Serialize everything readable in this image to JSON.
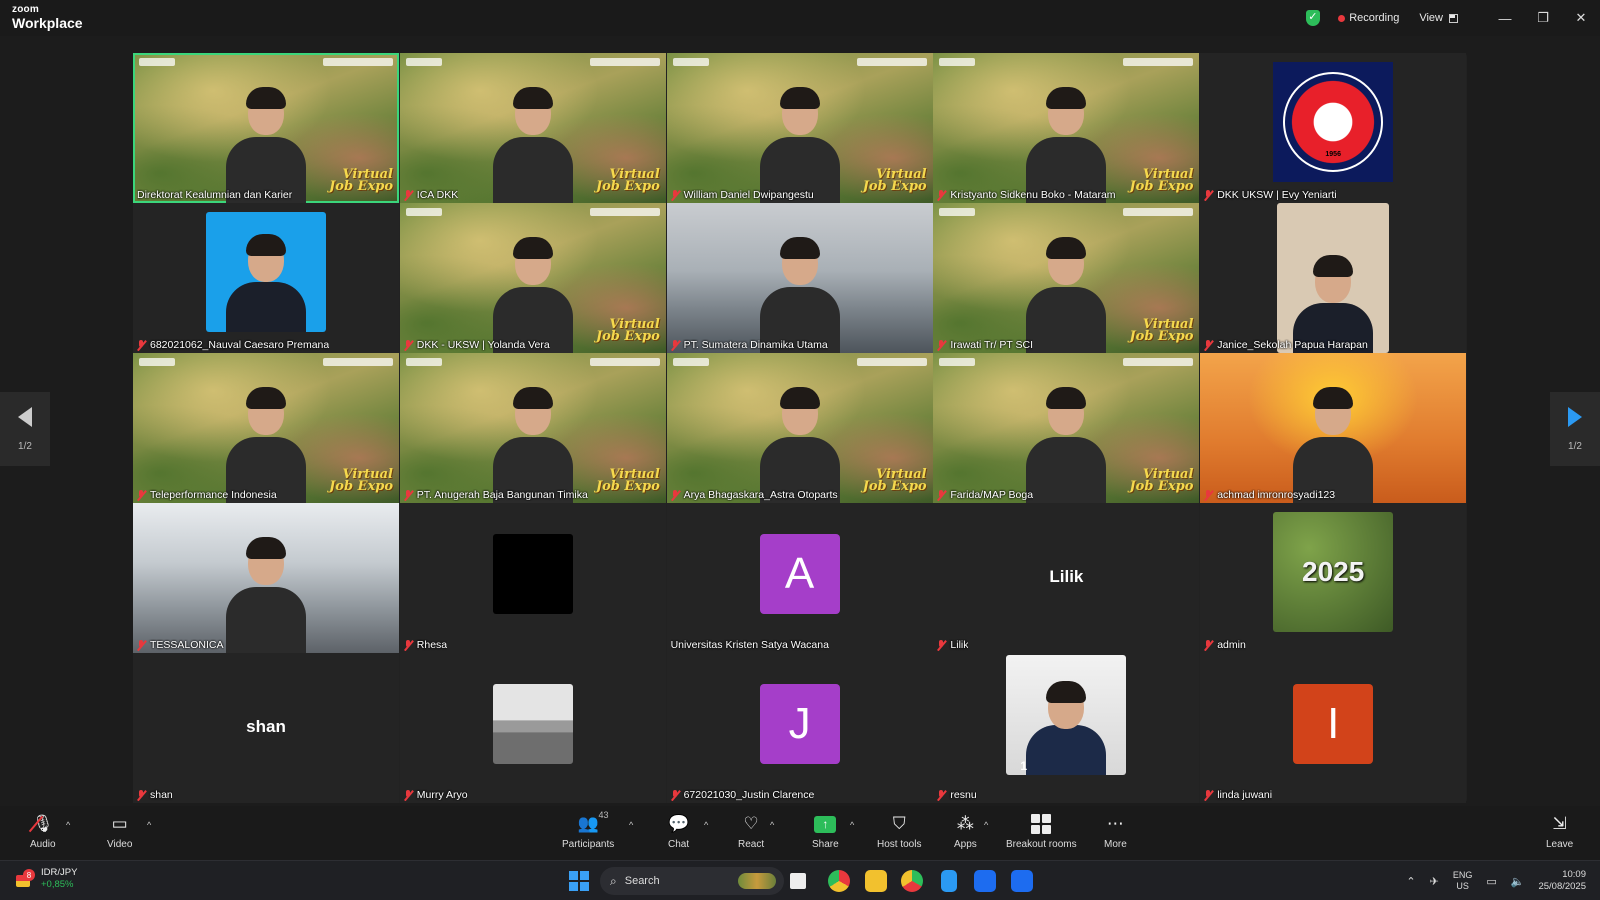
{
  "app": {
    "logo_top": "zoom",
    "logo_bottom": "Workplace",
    "recording_label": "Recording",
    "view_label": "View"
  },
  "window_controls": {
    "minimize": "—",
    "restore": "❐",
    "close": "✕"
  },
  "tiles": [
    {
      "name": "Direktorat Kealumnian dan Karier",
      "type": "video",
      "bg": "expo",
      "muted": false,
      "active": true
    },
    {
      "name": "ICA DKK",
      "type": "video",
      "bg": "expo",
      "muted": true
    },
    {
      "name": "William Daniel Dwipangestu",
      "type": "video",
      "bg": "expo",
      "muted": true
    },
    {
      "name": "Kristyanto Sidkenu Boko - Mataram",
      "type": "video",
      "bg": "expo",
      "muted": true
    },
    {
      "name": "DKK UKSW | Evy Yeniarti",
      "type": "avatar-seal",
      "muted": true
    },
    {
      "name": "682021062_Nauval Caesaro Premana",
      "type": "avatar-photo",
      "photo_bg": "#1aa0ea",
      "muted": true
    },
    {
      "name": "DKK - UKSW | Yolanda Vera",
      "type": "video",
      "bg": "expo",
      "muted": true
    },
    {
      "name": "PT. Sumatera Dinamika Utama",
      "type": "video",
      "bg": "office",
      "muted": true
    },
    {
      "name": "Irawati Tr/ PT SCI",
      "type": "video",
      "bg": "expo",
      "muted": true
    },
    {
      "name": "Janice_Sekolah Papua Harapan",
      "type": "avatar-photo-tall",
      "photo_bg": "#d9c9b3",
      "muted": true
    },
    {
      "name": "Teleperformance Indonesia",
      "type": "video",
      "bg": "expo",
      "muted": true
    },
    {
      "name": "PT. Anugerah Baja Bangunan Timika",
      "type": "video",
      "bg": "expo",
      "muted": true
    },
    {
      "name": "Arya Bhagaskara_Astra Otoparts",
      "type": "video",
      "bg": "expo",
      "muted": true
    },
    {
      "name": "Farida/MAP Boga",
      "type": "video",
      "bg": "expo",
      "muted": true
    },
    {
      "name": "achmad imronrosyadi123",
      "type": "video",
      "bg": "orange",
      "muted": true
    },
    {
      "name": "TESSALONICA",
      "type": "video",
      "bg": "photo",
      "muted": true
    },
    {
      "name": "Rhesa",
      "type": "avatar-black",
      "muted": true
    },
    {
      "name": "Universitas Kristen Satya Wacana",
      "type": "avatar-letter",
      "letter": "A",
      "color": "#a53ec9",
      "muted": false
    },
    {
      "name": "Lilik",
      "type": "avatar-text",
      "text": "Lilik",
      "muted": true
    },
    {
      "name": "admin",
      "type": "avatar-2025",
      "text": "2025",
      "muted": true
    },
    {
      "name": "shan",
      "type": "avatar-text",
      "text": "shan",
      "muted": true
    },
    {
      "name": "Murry Aryo",
      "type": "avatar-lake",
      "muted": true
    },
    {
      "name": "672021030_Justin Clarence",
      "type": "avatar-letter",
      "letter": "J",
      "color": "#a53ec9",
      "muted": true
    },
    {
      "name": "resnu",
      "type": "avatar-resnu",
      "badge": "1",
      "muted": true
    },
    {
      "name": "linda juwani",
      "type": "avatar-letter",
      "letter": "I",
      "color": "#d2431a",
      "muted": true
    }
  ],
  "expo_badge": {
    "line1": "Virtual",
    "line2": "Job Expo"
  },
  "pager": {
    "left_label": "1/2",
    "right_label": "1/2"
  },
  "toolbar": {
    "audio": "Audio",
    "video": "Video",
    "participants": "Participants",
    "participants_count": "43",
    "chat": "Chat",
    "react": "React",
    "share": "Share",
    "host_tools": "Host tools",
    "apps": "Apps",
    "breakout_rooms": "Breakout rooms",
    "more": "More",
    "leave": "Leave"
  },
  "taskbar": {
    "ticker_badge": "8",
    "ticker_pair": "IDR/JPY",
    "ticker_change": "+0,85%",
    "search_placeholder": "Search",
    "lang_top": "ENG",
    "lang_bottom": "US",
    "time": "10:09",
    "date": "25/08/2025"
  },
  "colors": {
    "accent_green": "#3bd67b",
    "record_red": "#e8383d",
    "share_green": "#2dbd5a",
    "pager_blue": "#2b9af3"
  }
}
